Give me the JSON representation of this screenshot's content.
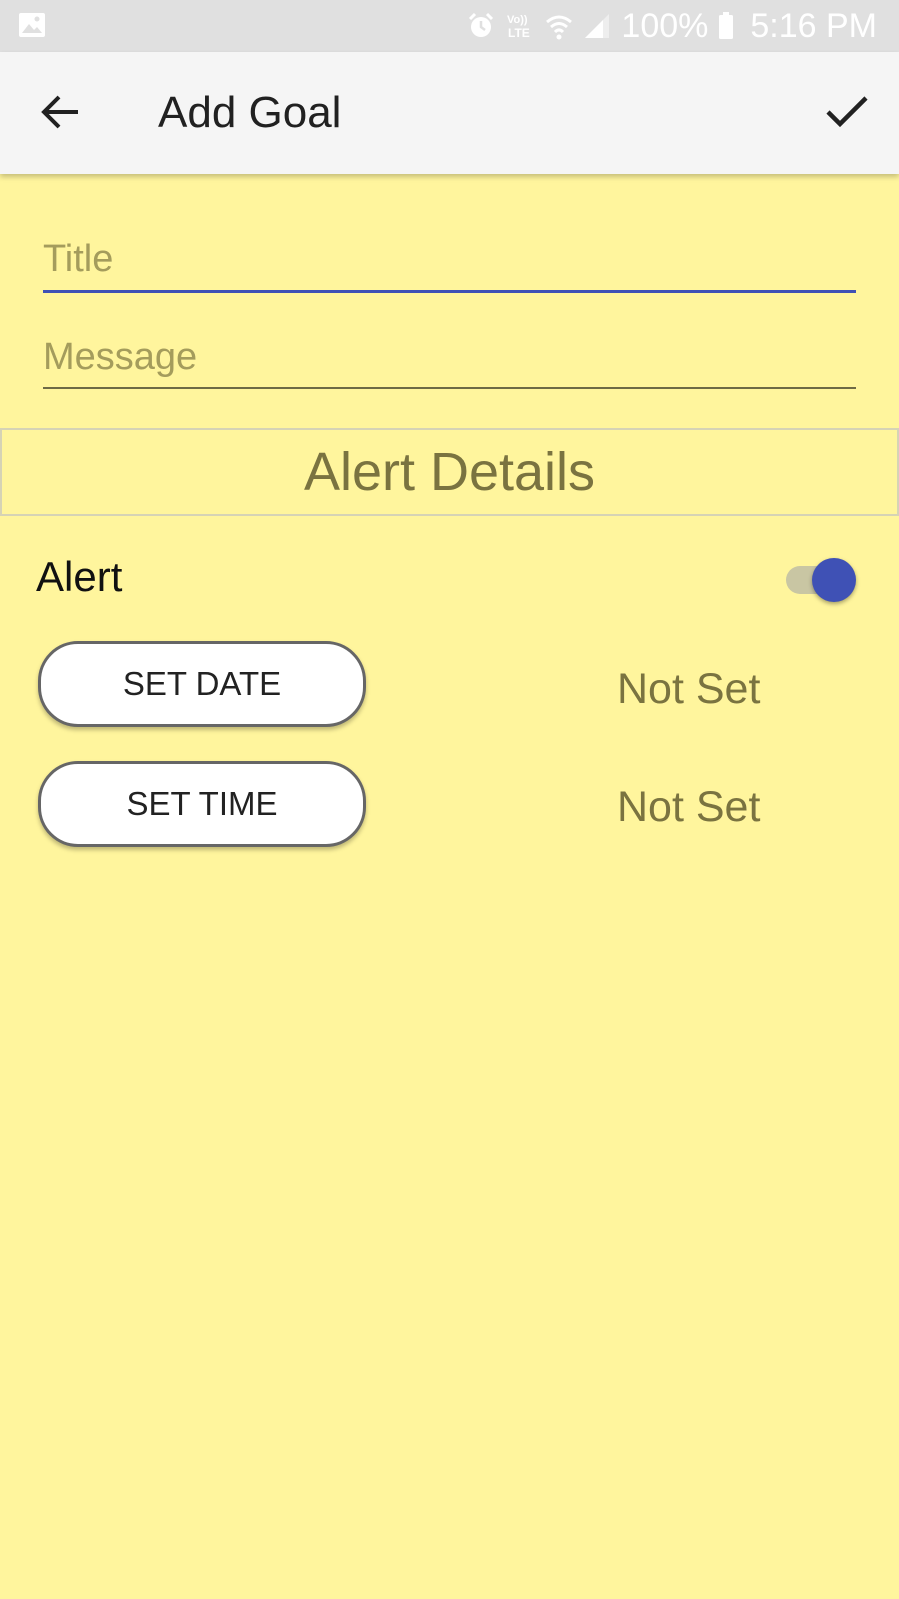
{
  "status_bar": {
    "icons": [
      "gallery-icon",
      "alarm-icon",
      "volte-icon",
      "wifi-icon",
      "signal-icon",
      "battery-icon"
    ],
    "volte_label": "Vo)) LTE",
    "battery": "100%",
    "time": "5:16 PM"
  },
  "app_bar": {
    "title": "Add Goal",
    "back_icon": "arrow-left-icon",
    "save_icon": "check-icon"
  },
  "form": {
    "title_placeholder": "Title",
    "title_value": "",
    "message_placeholder": "Message",
    "message_value": ""
  },
  "alert_section": {
    "header": "Alert Details",
    "alert_label": "Alert",
    "alert_enabled": true,
    "set_date_label": "SET DATE",
    "date_value": "Not Set",
    "set_time_label": "SET TIME",
    "time_value": "Not Set"
  },
  "colors": {
    "background": "#FFF59D",
    "accent": "#3F51B5",
    "app_bar": "#F5F5F5",
    "status_bar": "#E0E0E0",
    "muted_text": "#7A7340"
  }
}
